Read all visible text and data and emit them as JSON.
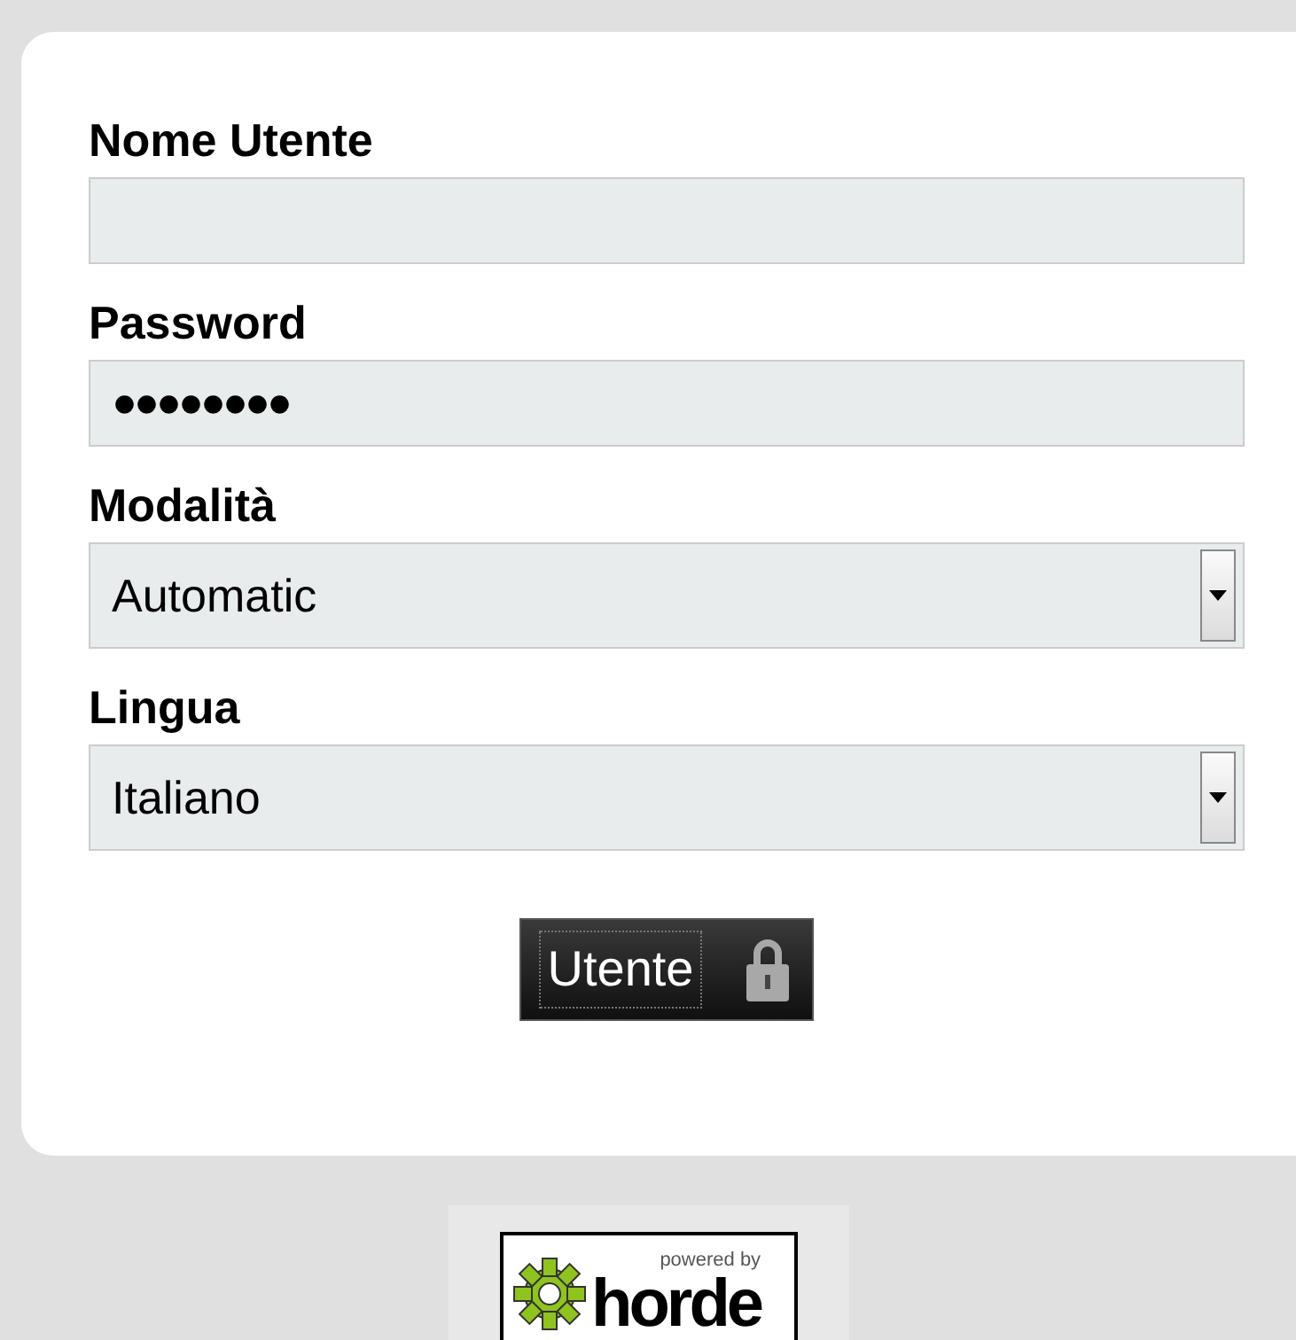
{
  "form": {
    "fields": [
      {
        "kind": "text",
        "label": "Nome Utente"
      },
      {
        "kind": "password",
        "label": "Password",
        "value": "●●●●●●●●"
      },
      {
        "kind": "select",
        "label": "Modalità",
        "value": "Automatic"
      },
      {
        "kind": "select",
        "label": "Lingua",
        "value": "Italiano"
      }
    ],
    "submit": {
      "label": "Utente"
    }
  },
  "footer": {
    "logo_caption": "powered by",
    "logo_text": "horde"
  }
}
